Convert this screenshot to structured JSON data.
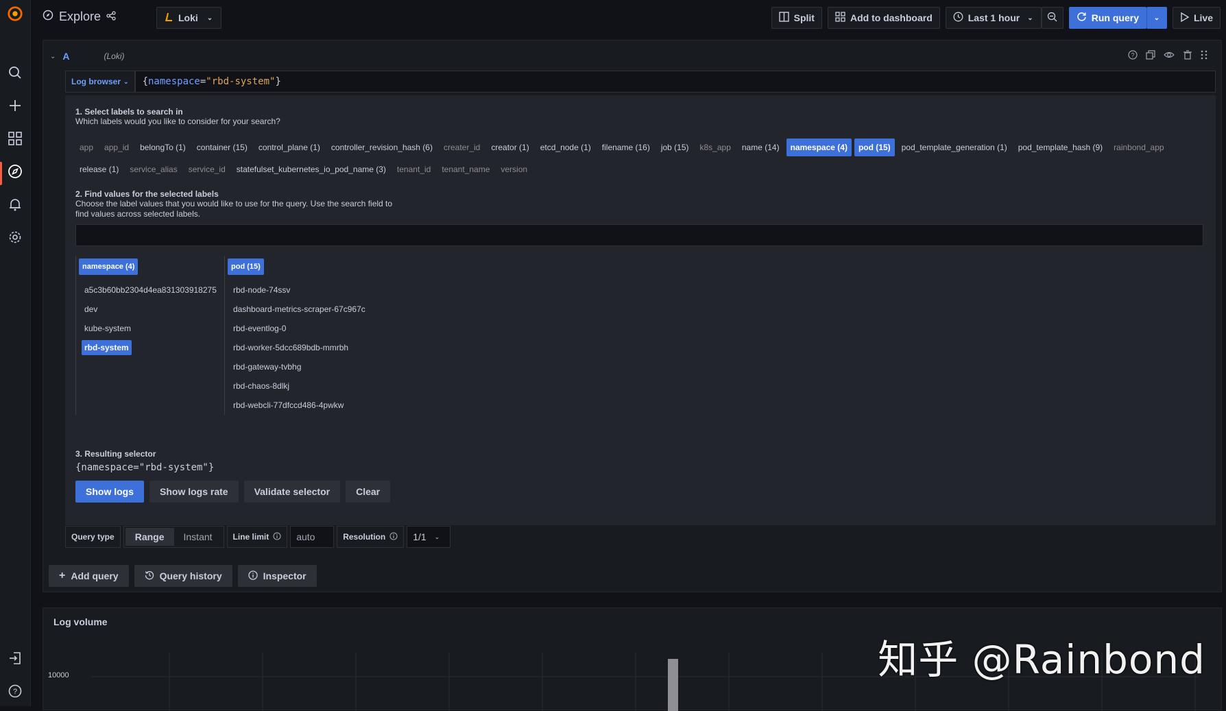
{
  "header": {
    "title": "Explore",
    "datasource": "Loki",
    "split_label": "Split",
    "add_dashboard_label": "Add to dashboard",
    "time_range": "Last 1 hour",
    "run_query_label": "Run query",
    "live_label": "Live"
  },
  "query": {
    "letter": "A",
    "datasource_hint": "(Loki)",
    "log_browser_label": "Log browser",
    "expr_open": "{",
    "expr_key": "namespace",
    "expr_eq": "=",
    "expr_val": "\"rbd-system\"",
    "expr_close": "}"
  },
  "browser": {
    "step1_title": "1. Select labels to search in",
    "step1_desc": "Which labels would you like to consider for your search?",
    "labels": [
      {
        "text": "app",
        "state": "dim"
      },
      {
        "text": "app_id",
        "state": "dim"
      },
      {
        "text": "belongTo (1)",
        "state": "normal"
      },
      {
        "text": "container (15)",
        "state": "normal"
      },
      {
        "text": "control_plane (1)",
        "state": "normal"
      },
      {
        "text": "controller_revision_hash (6)",
        "state": "normal"
      },
      {
        "text": "creater_id",
        "state": "dim"
      },
      {
        "text": "creator (1)",
        "state": "normal"
      },
      {
        "text": "etcd_node (1)",
        "state": "normal"
      },
      {
        "text": "filename (16)",
        "state": "normal"
      },
      {
        "text": "job (15)",
        "state": "normal"
      },
      {
        "text": "k8s_app",
        "state": "dim"
      },
      {
        "text": "name (14)",
        "state": "normal"
      },
      {
        "text": "namespace (4)",
        "state": "sel"
      },
      {
        "text": "pod (15)",
        "state": "sel"
      },
      {
        "text": "pod_template_generation (1)",
        "state": "normal"
      },
      {
        "text": "pod_template_hash (9)",
        "state": "normal"
      },
      {
        "text": "rainbond_app",
        "state": "dim"
      },
      {
        "text": "release (1)",
        "state": "normal"
      },
      {
        "text": "service_alias",
        "state": "dim"
      },
      {
        "text": "service_id",
        "state": "dim"
      },
      {
        "text": "statefulset_kubernetes_io_pod_name (3)",
        "state": "normal"
      },
      {
        "text": "tenant_id",
        "state": "dim"
      },
      {
        "text": "tenant_name",
        "state": "dim"
      },
      {
        "text": "version",
        "state": "dim"
      }
    ],
    "step2_title": "2. Find values for the selected labels",
    "step2_desc_1": "Choose the label values that you would like to use for the query. Use the search field to",
    "step2_desc_2": "find values across selected labels.",
    "columns": [
      {
        "title": "namespace (4)",
        "values": [
          {
            "text": "a5c3b60bb2304d4ea831303918275",
            "sel": false
          },
          {
            "text": "dev",
            "sel": false
          },
          {
            "text": "kube-system",
            "sel": false
          },
          {
            "text": "rbd-system",
            "sel": true
          }
        ]
      },
      {
        "title": "pod (15)",
        "values": [
          {
            "text": "rbd-node-74ssv",
            "sel": false
          },
          {
            "text": "dashboard-metrics-scraper-67c967c",
            "sel": false
          },
          {
            "text": "rbd-eventlog-0",
            "sel": false
          },
          {
            "text": "rbd-worker-5dcc689bdb-mmrbh",
            "sel": false
          },
          {
            "text": "rbd-gateway-tvbhg",
            "sel": false
          },
          {
            "text": "rbd-chaos-8dlkj",
            "sel": false
          },
          {
            "text": "rbd-webcli-77dfccd486-4pwkw",
            "sel": false
          }
        ]
      }
    ],
    "step3_title": "3. Resulting selector",
    "result": "{namespace=\"rbd-system\"}",
    "show_logs": "Show logs",
    "show_logs_rate": "Show logs rate",
    "validate": "Validate selector",
    "clear": "Clear"
  },
  "options": {
    "query_type_label": "Query type",
    "range": "Range",
    "instant": "Instant",
    "line_limit_label": "Line limit",
    "line_limit_placeholder": "auto",
    "resolution_label": "Resolution",
    "resolution_value": "1/1"
  },
  "footer_buttons": {
    "add_query": "Add query",
    "query_history": "Query history",
    "inspector": "Inspector"
  },
  "log_volume": {
    "title": "Log volume",
    "y_tick": "10000"
  },
  "watermark": "知乎 @Rainbond"
}
